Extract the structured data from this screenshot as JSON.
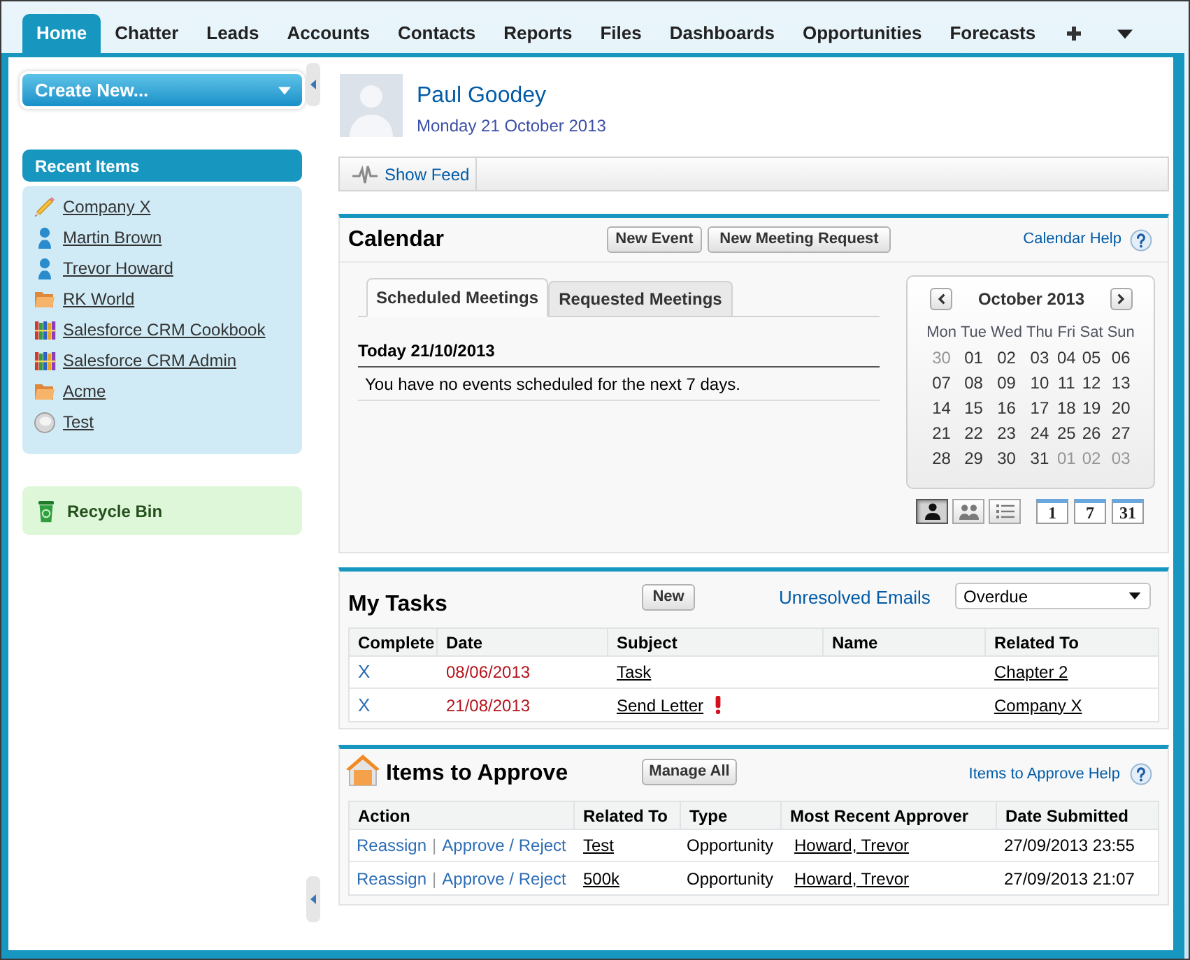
{
  "tabs": [
    {
      "label": "Home",
      "selected": true
    },
    {
      "label": "Chatter",
      "selected": false
    },
    {
      "label": "Leads",
      "selected": false
    },
    {
      "label": "Accounts",
      "selected": false
    },
    {
      "label": "Contacts",
      "selected": false
    },
    {
      "label": "Reports",
      "selected": false
    },
    {
      "label": "Files",
      "selected": false
    },
    {
      "label": "Dashboards",
      "selected": false
    },
    {
      "label": "Opportunities",
      "selected": false
    },
    {
      "label": "Forecasts",
      "selected": false
    }
  ],
  "sidebar": {
    "create_button": "Create New...",
    "recent_items": {
      "title": "Recent Items",
      "items": [
        {
          "label": "Company X",
          "kind": "pencil"
        },
        {
          "label": "Martin Brown",
          "kind": "person"
        },
        {
          "label": "Trevor Howard",
          "kind": "person"
        },
        {
          "label": "RK World",
          "kind": "folder"
        },
        {
          "label": "Salesforce CRM Cookbook",
          "kind": "books"
        },
        {
          "label": "Salesforce CRM Admin",
          "kind": "books"
        },
        {
          "label": "Acme",
          "kind": "folder"
        },
        {
          "label": "Test",
          "kind": "coin"
        }
      ]
    },
    "recycle_bin": "Recycle Bin"
  },
  "profile": {
    "name": "Paul Goodey",
    "date": "Monday 21 October 2013"
  },
  "feed_button": "Show Feed",
  "calendar": {
    "title": "Calendar",
    "buttons": [
      "New Event",
      "New Meeting Request"
    ],
    "help_link": "Calendar Help",
    "tabs": [
      {
        "label": "Scheduled Meetings",
        "selected": true
      },
      {
        "label": "Requested Meetings",
        "selected": false
      }
    ],
    "day_heading": "Today 21/10/2013",
    "message": "You have no events scheduled for the next 7 days.",
    "mini_calendar": {
      "month": "October 2013",
      "weekdays": [
        "Mon",
        "Tue",
        "Wed",
        "Thu",
        "Fri",
        "Sat",
        "Sun"
      ],
      "weeks": [
        [
          {
            "day": "30",
            "other_month": true
          },
          {
            "day": "01",
            "other_month": false
          },
          {
            "day": "02",
            "other_month": false
          },
          {
            "day": "03",
            "other_month": false
          },
          {
            "day": "04",
            "other_month": false
          },
          {
            "day": "05",
            "other_month": false
          },
          {
            "day": "06",
            "other_month": false
          }
        ],
        [
          {
            "day": "07",
            "other_month": false
          },
          {
            "day": "08",
            "other_month": false
          },
          {
            "day": "09",
            "other_month": false
          },
          {
            "day": "10",
            "other_month": false
          },
          {
            "day": "11",
            "other_month": false
          },
          {
            "day": "12",
            "other_month": false
          },
          {
            "day": "13",
            "other_month": false
          }
        ],
        [
          {
            "day": "14",
            "other_month": false
          },
          {
            "day": "15",
            "other_month": false
          },
          {
            "day": "16",
            "other_month": false
          },
          {
            "day": "17",
            "other_month": false
          },
          {
            "day": "18",
            "other_month": false
          },
          {
            "day": "19",
            "other_month": false
          },
          {
            "day": "20",
            "other_month": false
          }
        ],
        [
          {
            "day": "21",
            "other_month": false
          },
          {
            "day": "22",
            "other_month": false
          },
          {
            "day": "23",
            "other_month": false
          },
          {
            "day": "24",
            "other_month": false
          },
          {
            "day": "25",
            "other_month": false
          },
          {
            "day": "26",
            "other_month": false
          },
          {
            "day": "27",
            "other_month": false
          }
        ],
        [
          {
            "day": "28",
            "other_month": false
          },
          {
            "day": "29",
            "other_month": false
          },
          {
            "day": "30",
            "other_month": false
          },
          {
            "day": "31",
            "other_month": false
          },
          {
            "day": "01",
            "other_month": true
          },
          {
            "day": "02",
            "other_month": true
          },
          {
            "day": "03",
            "other_month": true
          }
        ]
      ]
    },
    "view_buttons": [
      {
        "kind": "person",
        "selected": true
      },
      {
        "kind": "group",
        "selected": false
      },
      {
        "kind": "list",
        "selected": false
      }
    ],
    "range_buttons": [
      "1",
      "7",
      "31"
    ]
  },
  "tasks": {
    "title": "My Tasks",
    "new_button": "New",
    "emails_link": "Unresolved Emails",
    "filter": {
      "value": "Overdue"
    },
    "table": {
      "columns": [
        "Complete",
        "Date",
        "Subject",
        "Name",
        "Related To"
      ],
      "rows": [
        {
          "complete": "X",
          "date": "08/06/2013",
          "overdue": true,
          "subject": "Task",
          "high_priority": false,
          "related_to": "Chapter 2"
        },
        {
          "complete": "X",
          "date": "21/08/2013",
          "overdue": true,
          "subject": "Send Letter",
          "high_priority": true,
          "related_to": "Company X"
        }
      ]
    }
  },
  "approvals": {
    "title": "Items to Approve",
    "manage_button": "Manage All",
    "help_link": "Items to Approve Help",
    "table": {
      "columns": [
        "Action",
        "Related To",
        "Type",
        "Most Recent Approver",
        "Date Submitted"
      ],
      "rows": [
        {
          "actions": [
            "Reassign",
            "Approve / Reject"
          ],
          "separator": "|",
          "related_to": "Test",
          "type": "Opportunity",
          "approver": "Howard, Trevor",
          "submitted": "27/09/2013 23:55"
        },
        {
          "actions": [
            "Reassign",
            "Approve / Reject"
          ],
          "separator": "|",
          "related_to": "500k",
          "type": "Opportunity",
          "approver": "Howard, Trevor",
          "submitted": "27/09/2013 21:07"
        }
      ]
    }
  }
}
